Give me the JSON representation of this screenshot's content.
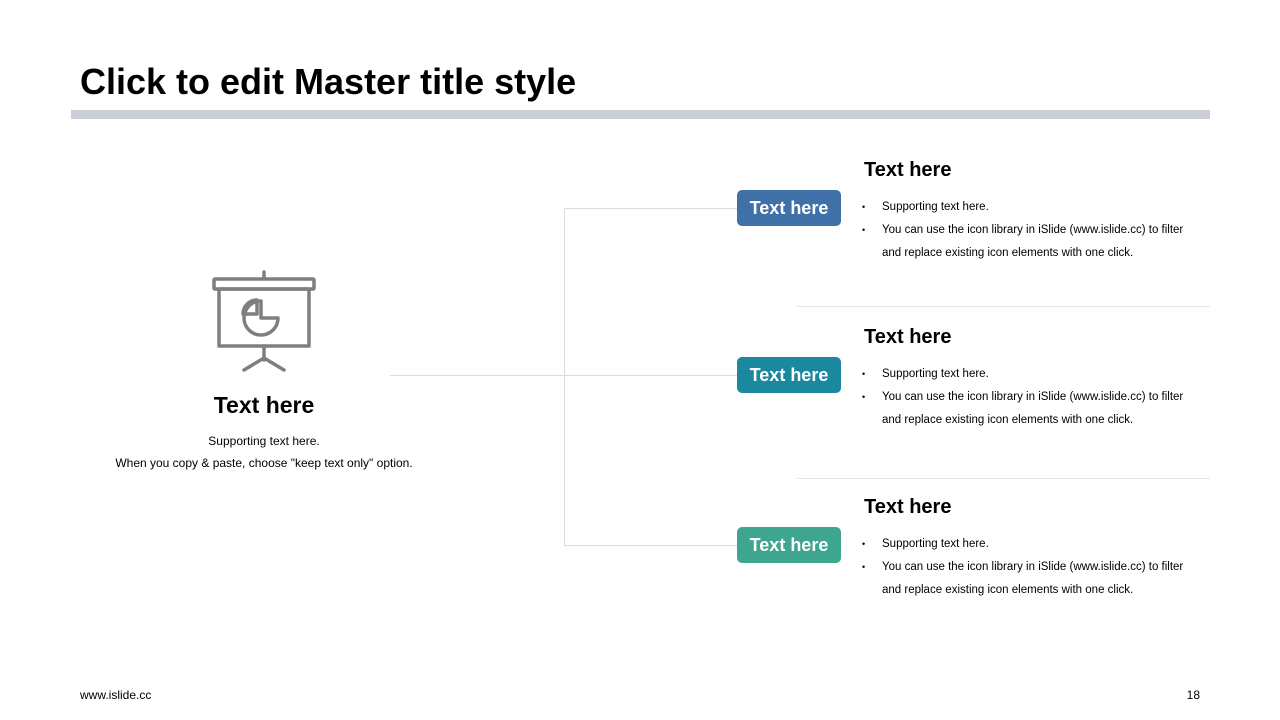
{
  "slide": {
    "title": "Click to edit Master title style",
    "footer_url": "www.islide.cc",
    "page_number": "18"
  },
  "left": {
    "icon": "presentation-board-pie-chart-icon",
    "heading": "Text here",
    "support_line_1": "Supporting text here.",
    "support_line_2": "When you copy & paste, choose \"keep text only\" option."
  },
  "items": [
    {
      "pill_label": "Text here",
      "pill_color": "#3f70a8",
      "heading": "Text here",
      "bullets": [
        "Supporting text here.",
        "You can use the icon library in iSlide  (www.islide.cc) to filter and replace existing icon elements with one click."
      ]
    },
    {
      "pill_label": "Text here",
      "pill_color": "#1b88a0",
      "heading": "Text here",
      "bullets": [
        "Supporting text here.",
        "You can use the icon library in iSlide  (www.islide.cc) to filter and replace existing icon elements with one click."
      ]
    },
    {
      "pill_label": "Text here",
      "pill_color": "#3ea58f",
      "heading": "Text here",
      "bullets": [
        "Supporting text here.",
        "You can use the icon library in iSlide  (www.islide.cc) to filter and replace existing icon elements with one click."
      ]
    }
  ],
  "colors": {
    "title_bar": "#cbcfd8",
    "icon_stroke": "#7f7f7f",
    "connector_line": "#dcdcdc"
  }
}
